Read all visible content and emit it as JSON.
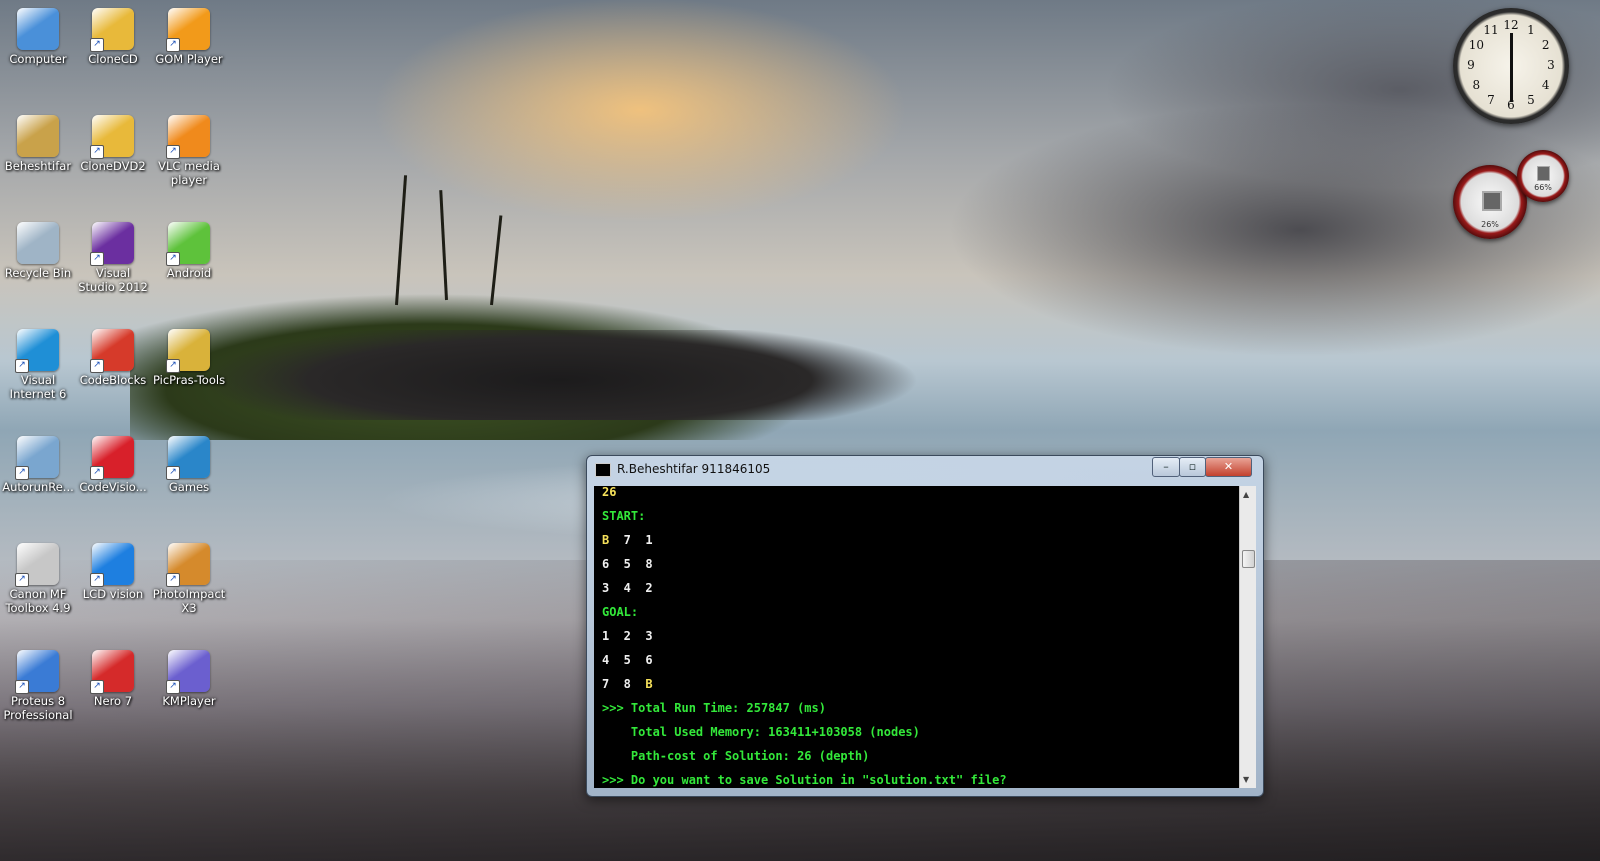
{
  "desktop": {
    "icons": [
      {
        "label": "Computer",
        "icon": "computer-icon",
        "color": "#4a90d9"
      },
      {
        "label": "CloneCD",
        "icon": "clonecd-icon",
        "color": "#e8b93a"
      },
      {
        "label": "GOM Player",
        "icon": "gom-player-icon",
        "color": "#f29a1a"
      },
      {
        "label": "Beheshtifar",
        "icon": "user-folder-icon",
        "color": "#c9a24a"
      },
      {
        "label": "CloneDVD2",
        "icon": "clonedvd-icon",
        "color": "#e8b93a"
      },
      {
        "label": "VLC media player",
        "icon": "vlc-icon",
        "color": "#f08a1c"
      },
      {
        "label": "Recycle Bin",
        "icon": "recycle-bin-icon",
        "color": "#9fb4c6"
      },
      {
        "label": "Visual Studio 2012",
        "icon": "visual-studio-icon",
        "color": "#6b2fa0"
      },
      {
        "label": "Android",
        "icon": "bluestacks-icon",
        "color": "#5ec23b"
      },
      {
        "label": "Visual Internet 6",
        "icon": "globe-icon",
        "color": "#1f8fd6"
      },
      {
        "label": "CodeBlocks",
        "icon": "codeblocks-icon",
        "color": "#d63a2a"
      },
      {
        "label": "PicPras-Tools",
        "icon": "picpras-icon",
        "color": "#d9b23a"
      },
      {
        "label": "AutorunRe...",
        "icon": "autorun-icon",
        "color": "#7aa6cf"
      },
      {
        "label": "CodeVisio...",
        "icon": "codevision-icon",
        "color": "#d8202a"
      },
      {
        "label": "Games",
        "icon": "games-icon",
        "color": "#2a86c9"
      },
      {
        "label": "Canon MF Toolbox 4.9",
        "icon": "canon-toolbox-icon",
        "color": "#c7c7c7"
      },
      {
        "label": "LCD vision",
        "icon": "lcd-vision-icon",
        "color": "#1e7fe0"
      },
      {
        "label": "PhotoImpact X3",
        "icon": "photoimpact-icon",
        "color": "#d58a2c"
      },
      {
        "label": "Proteus 8 Professional",
        "icon": "proteus-icon",
        "color": "#3a7bd5"
      },
      {
        "label": "Nero 7",
        "icon": "nero-icon",
        "color": "#d52a2a"
      },
      {
        "label": "KMPlayer",
        "icon": "kmplayer-icon",
        "color": "#6b5fcf"
      }
    ]
  },
  "gadgets": {
    "clock": {
      "numbers": [
        "12",
        "1",
        "2",
        "3",
        "4",
        "5",
        "6",
        "7",
        "8",
        "9",
        "10",
        "11"
      ]
    },
    "cpu_meter": {
      "cpu": "26%",
      "memory": "66%"
    }
  },
  "console_window": {
    "title": "R.Beheshtifar 911846105",
    "buttons": {
      "minimize": "–",
      "maximize": "▫",
      "close": "✕"
    },
    "lines": [
      {
        "text": "26",
        "color": "y"
      },
      {
        "text": "START:",
        "color": "g"
      },
      {
        "text": "B",
        "color": "y",
        "rest": "  7  1"
      },
      {
        "text": "6  5  8",
        "color": "w"
      },
      {
        "text": "3  4  2",
        "color": "w"
      },
      {
        "text": "GOAL:",
        "color": "g"
      },
      {
        "text": "1  2  3",
        "color": "w"
      },
      {
        "text": "4  5  6",
        "color": "w"
      },
      {
        "text": "7  8  ",
        "color": "w",
        "tail": "B"
      },
      {
        "text": ">>> Total Run Time: 257847 (ms)",
        "color": "g"
      },
      {
        "text": "    Total Used Memory: 163411+103058 (nodes)",
        "color": "g"
      },
      {
        "text": "    Path-cost of Solution: 26 (depth)",
        "color": "g"
      },
      {
        "text": ">>> Do you want to save Solution in \"solution.txt\" file?",
        "color": "g"
      }
    ]
  }
}
